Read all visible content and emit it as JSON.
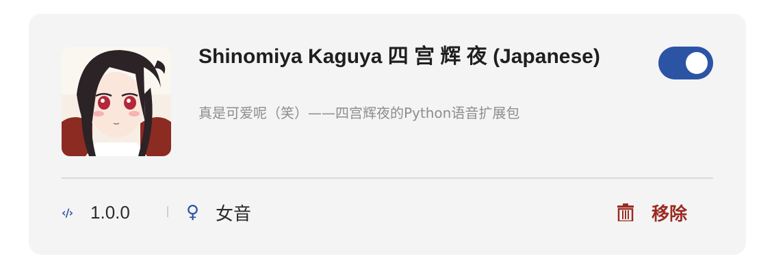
{
  "card": {
    "title": "Shinomiya Kaguya 四 宫 辉 夜 (Japanese)",
    "description": "真是可爱呢（笑）——四宫辉夜的Python语音扩展包",
    "enabled": true,
    "version": "1.0.0",
    "voice": "女音",
    "remove_label": "移除"
  },
  "icons": {
    "version": "code-icon",
    "voice": "female-symbol-icon",
    "remove": "trash-icon",
    "toggle": "toggle-switch"
  },
  "colors": {
    "accent": "#2c54a4",
    "danger": "#9b2b22",
    "card_background": "#f4f4f5",
    "subtitle": "#8d8d8d"
  }
}
